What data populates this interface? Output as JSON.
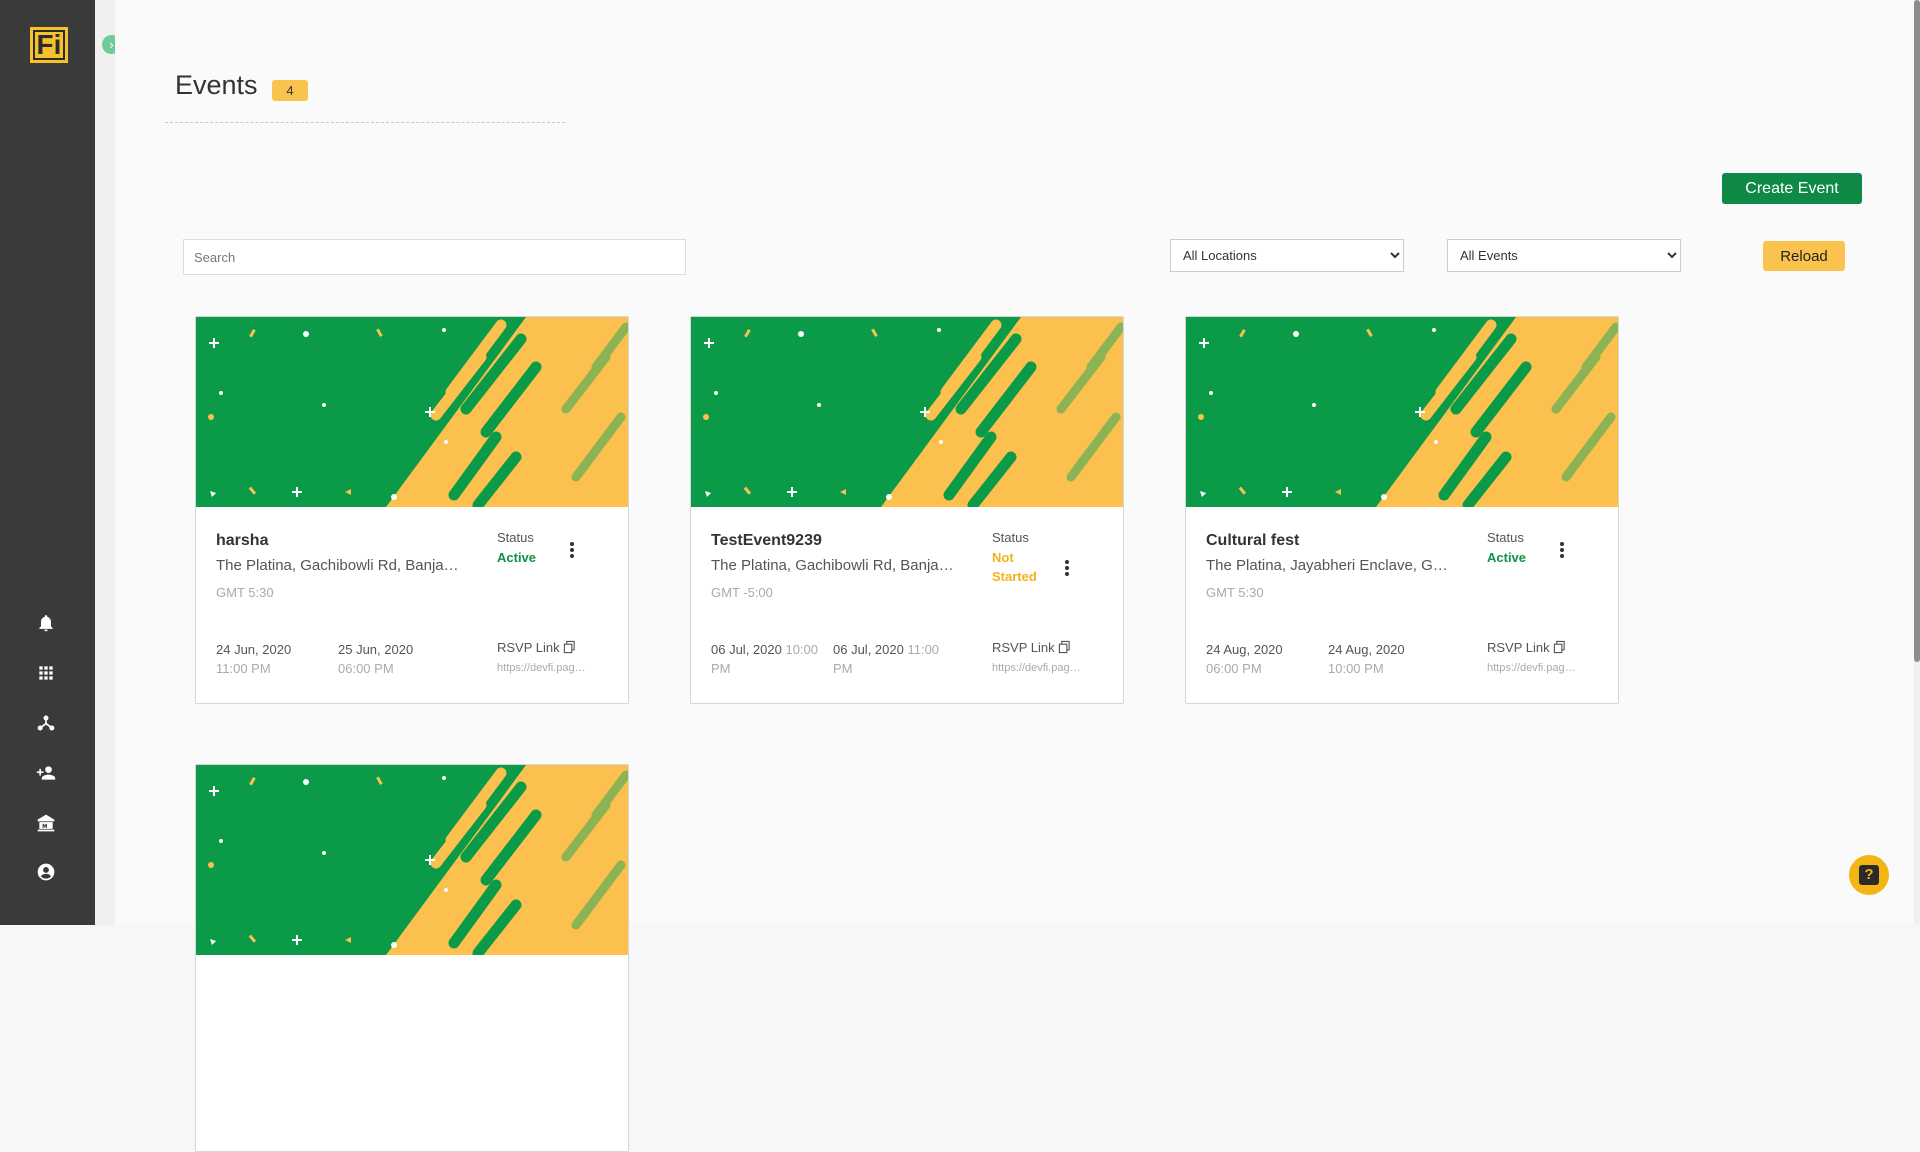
{
  "app": {
    "logo_text": "Fi"
  },
  "header": {
    "title": "Events",
    "count": "4"
  },
  "toolbar": {
    "create_label": "Create Event",
    "search_placeholder": "Search",
    "location_filter": "All Locations",
    "event_filter": "All Events",
    "reload_label": "Reload"
  },
  "events": [
    {
      "name": "harsha",
      "location": "The Platina, Gachibowli Rd, Banjara Hills",
      "timezone": "GMT 5:30",
      "status_label": "Status",
      "status": "Active",
      "start_date": "24 Jun, 2020",
      "start_time": "11:00 PM",
      "end_date": "25 Jun, 2020",
      "end_time": "06:00 PM",
      "rsvp_label": "RSVP Link",
      "rsvp_url": "https://devfi.page.link"
    },
    {
      "name": "TestEvent9239",
      "location": "The Platina, Gachibowli Rd, Banjara Hills",
      "timezone": "GMT -5:00",
      "status_label": "Status",
      "status": "Not Started",
      "start_date": "06 Jul, 2020",
      "start_time": "10:00 PM",
      "end_date": "06 Jul, 2020",
      "end_time": "11:00 PM",
      "rsvp_label": "RSVP Link",
      "rsvp_url": "https://devfi.page.link"
    },
    {
      "name": "Cultural fest",
      "location": "The Platina, Jayabheri Enclave, Gachibowli",
      "timezone": "GMT 5:30",
      "status_label": "Status",
      "status": "Active",
      "start_date": "24 Aug, 2020",
      "start_time": "06:00 PM",
      "end_date": "24 Aug, 2020",
      "end_time": "10:00 PM",
      "rsvp_label": "RSVP Link",
      "rsvp_url": "https://devfi.page.link"
    }
  ],
  "sidebar": {
    "icons": [
      "bell-icon",
      "apps-grid-icon",
      "network-icon",
      "add-user-icon",
      "institution-icon",
      "account-icon"
    ]
  },
  "help": {
    "label": "?"
  },
  "colors": {
    "green": "#0f8a46",
    "yellow": "#f9c34e",
    "sidebar": "#3a3a3a"
  }
}
